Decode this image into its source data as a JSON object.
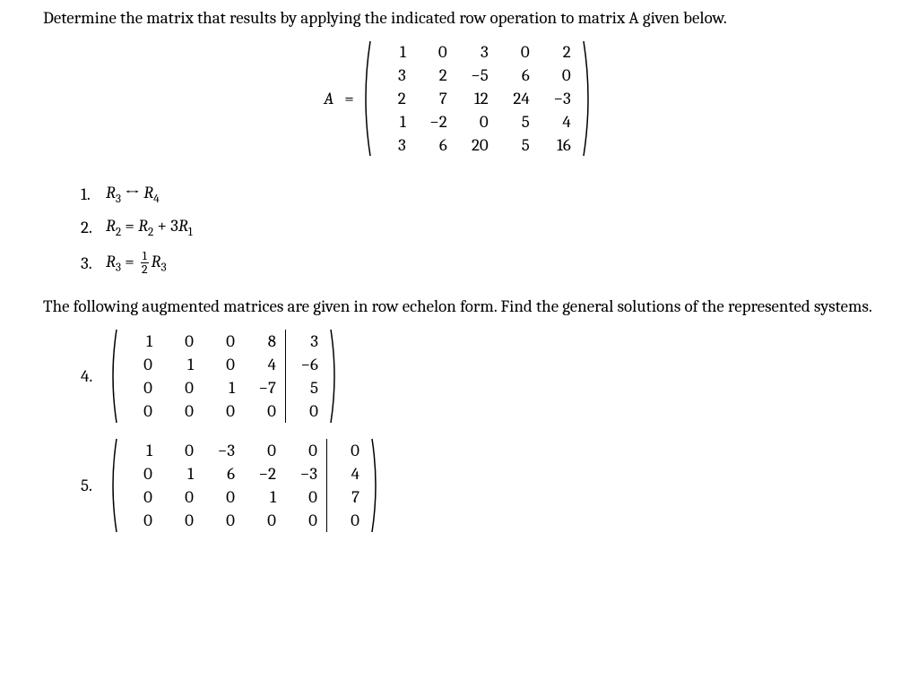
{
  "prompt1": "Determine the matrix that results by applying the indicated row operation to matrix A given below.",
  "A_lhs": "A",
  "eq": "=",
  "A": [
    [
      "1",
      "0",
      "3",
      "0",
      "2"
    ],
    [
      "3",
      "2",
      "−5",
      "6",
      "0"
    ],
    [
      "2",
      "7",
      "12",
      "24",
      "−3"
    ],
    [
      "1",
      "−2",
      "0",
      "5",
      "4"
    ],
    [
      "3",
      "6",
      "20",
      "5",
      "16"
    ]
  ],
  "ops": {
    "n1": "1.",
    "n2": "2.",
    "n3": "3.",
    "op1_lhs_R": "R",
    "op1_lhs_sub": "3",
    "op1_arrow": " ↔ ",
    "op1_rhs_R": "R",
    "op1_rhs_sub": "4",
    "op2_l_R": "R",
    "op2_l_sub": "2",
    "op2_eq": " = ",
    "op2_r1_R": "R",
    "op2_r1_sub": "2",
    "op2_plus": " + 3",
    "op2_r2_R": "R",
    "op2_r2_sub": "1",
    "op3_l_R": "R",
    "op3_l_sub": "3",
    "op3_eq": " = ",
    "op3_frac_n": "1",
    "op3_frac_d": "2",
    "op3_r_R": "R",
    "op3_r_sub": "3"
  },
  "prompt2": "The following augmented matrices are given in row echelon form.  Find the general solutions of the represented systems.",
  "q4": {
    "num": "4.",
    "left": [
      [
        "1",
        "0",
        "0",
        "8"
      ],
      [
        "0",
        "1",
        "0",
        "4"
      ],
      [
        "0",
        "0",
        "1",
        "−7"
      ],
      [
        "0",
        "0",
        "0",
        "0"
      ]
    ],
    "right": [
      [
        "3"
      ],
      [
        "−6"
      ],
      [
        "5"
      ],
      [
        "0"
      ]
    ]
  },
  "q5": {
    "num": "5.",
    "left": [
      [
        "1",
        "0",
        "−3",
        "0",
        "0"
      ],
      [
        "0",
        "1",
        "6",
        "−2",
        "−3"
      ],
      [
        "0",
        "0",
        "0",
        "1",
        "0"
      ],
      [
        "0",
        "0",
        "0",
        "0",
        "0"
      ]
    ],
    "right": [
      [
        "0"
      ],
      [
        "4"
      ],
      [
        "7"
      ],
      [
        "0"
      ]
    ]
  }
}
